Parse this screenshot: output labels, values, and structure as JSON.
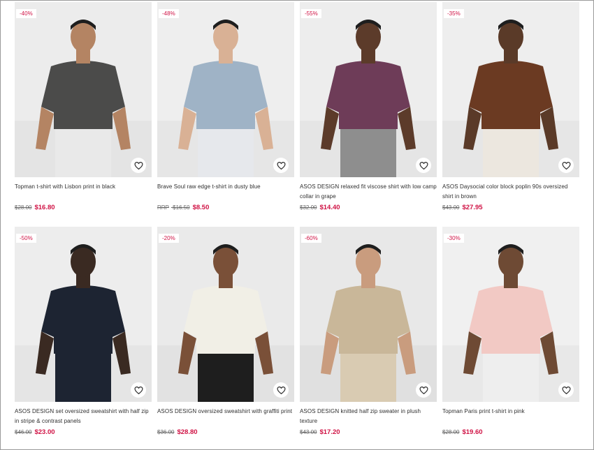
{
  "colors": {
    "sale": "#d01345",
    "text": "#2d2d2d",
    "muted": "#666666"
  },
  "products": [
    {
      "discount": "-40%",
      "title": "Topman t-shirt with Lisbon print in black",
      "old_price": "$28.00",
      "rrp_label": "",
      "price": "$16.80",
      "bg": "#ececec",
      "garment": "#4b4b4a",
      "lower": "#e9e9e9",
      "skin": "#b48463"
    },
    {
      "discount": "-48%",
      "title": "Brave Soul raw edge t-shirt in dusty blue",
      "old_price": "$16.50",
      "rrp_label": "RRP",
      "price": "$8.50",
      "bg": "#eeeeee",
      "garment": "#9fb3c6",
      "lower": "#e6e8ec",
      "skin": "#d9b195"
    },
    {
      "discount": "-55%",
      "title": "ASOS DESIGN relaxed fit viscose shirt with low camp collar in grape",
      "old_price": "$32.00",
      "rrp_label": "",
      "price": "$14.40",
      "bg": "#ededed",
      "garment": "#6e3c58",
      "lower": "#8e8e8e",
      "skin": "#5c3b2a"
    },
    {
      "discount": "-35%",
      "title": "ASOS Daysocial color block poplin 90s oversized shirt in brown",
      "old_price": "$43.00",
      "rrp_label": "",
      "price": "$27.95",
      "bg": "#eeeeee",
      "garment": "#6b3a22",
      "lower": "#ece7df",
      "skin": "#5a3a28"
    },
    {
      "discount": "-50%",
      "title": "ASOS DESIGN set oversized sweatshirt with half zip in stripe & contrast panels",
      "old_price": "$46.00",
      "rrp_label": "",
      "price": "$23.00",
      "bg": "#ededed",
      "garment": "#1d2432",
      "lower": "#1d2432",
      "skin": "#3a2a22"
    },
    {
      "discount": "-20%",
      "title": "ASOS DESIGN oversized sweatshirt with graffiti print",
      "old_price": "$36.00",
      "rrp_label": "",
      "price": "$28.80",
      "bg": "#eaeaea",
      "garment": "#f1efe6",
      "lower": "#1e1e1e",
      "skin": "#7a5038"
    },
    {
      "discount": "-60%",
      "title": "ASOS DESIGN knitted half zip sweater in plush texture",
      "old_price": "$43.00",
      "rrp_label": "",
      "price": "$17.20",
      "bg": "#e8e8e8",
      "garment": "#c9b799",
      "lower": "#d9cbb2",
      "skin": "#c99c7e"
    },
    {
      "discount": "-30%",
      "title": "Topman Paris print t-shirt in pink",
      "old_price": "$28.00",
      "rrp_label": "",
      "price": "$19.60",
      "bg": "#f0f0f0",
      "garment": "#f2c9c4",
      "lower": "#eeeeee",
      "skin": "#6e4a34"
    }
  ]
}
